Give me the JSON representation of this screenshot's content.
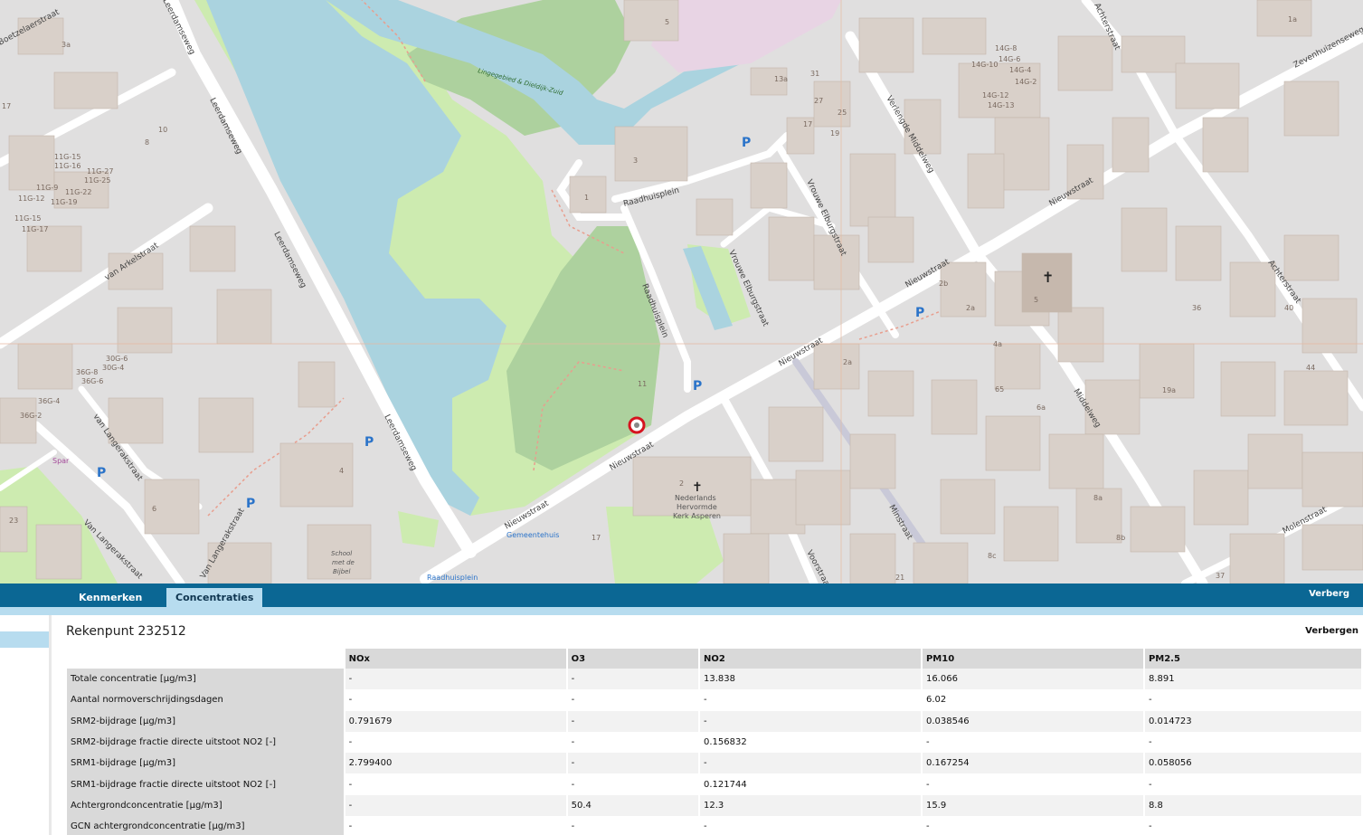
{
  "map": {
    "streets": {
      "leerdamseweg": "Leerdamseweg",
      "leerdamseweg_2": "Leerdamseweg",
      "leerdamseweg_3": "Leerdamseweg",
      "van_arkelstraat": "van Arkelstraat",
      "van_langerakstraat": "van Langerakstraat",
      "van_langerakstraat_2": "Van Langerakstraat",
      "van_langerakstraat_3": "Van Langerakstraat",
      "raadhuisplein": "Raadhuisplein",
      "raadhuisplein_2": "Raadhuisplein",
      "nieuwstraat": "Nieuwstraat",
      "nieuwstraat_2": "Nieuwstraat",
      "nieuwstraat_3": "Nieuwstraat",
      "nieuwstraat_4": "Nieuwstraat",
      "nieuwstraat_5": "Nieuwstraat",
      "vrouwe_elburgstraat": "Vrouwe Elburgstraat",
      "vrouwe_elburgstraat_2": "Vrouwe Elburgstraat",
      "verlengde_middelweg": "Verlengde Middelweg",
      "middelweg": "Middelweg",
      "achterstraat": "Achterstraat",
      "achterstraat_2": "Achterstraat",
      "zevenhuizenseweg": "Zevenhuizenseweg",
      "molenstraat": "Molenstraat",
      "minstraat": "Minstraat",
      "voorstraat": "Voorstraat",
      "leerdamseweg_top": "Leerdamseweg",
      "boetzelaerstraat": "Boetzelaerstraat"
    },
    "pois": {
      "gemeentehuis": "Gemeentehuis",
      "raadhuisplein_stop": "Raadhuisplein",
      "spar": "Spar",
      "church": "Nederlands Hervormde Kerk Asperen",
      "church_l1": "Nederlands",
      "church_l2": "Hervormde",
      "church_l3": "Kerk Asperen",
      "school_l1": "School",
      "school_l2": "met de",
      "school_l3": "Bijbel",
      "lingegebied": "Lingegebied & Dieldijk-Zuid"
    },
    "house_numbers": {
      "h1": "5",
      "h2": "1a",
      "h3": "3a",
      "h4": "17",
      "h5": "10",
      "h6": "8",
      "h7": "11G-16",
      "h8": "11G-15",
      "h9": "11G-27",
      "h10": "11G-25",
      "h11": "11G-22",
      "h12": "11G-19",
      "h13": "11G-12",
      "h14": "11G-9",
      "h15": "11G-15",
      "h16": "11G-17",
      "h17": "30G-6",
      "h18": "30G-4",
      "h19": "36G-8",
      "h20": "36G-4",
      "h21": "36G-2",
      "h22": "36G-6",
      "h23": "14G-8",
      "h24": "14G-6",
      "h25": "14G-4",
      "h26": "14G-10",
      "h27": "14G-2",
      "h28": "14G-12",
      "h29": "14G-13",
      "h30": "13a",
      "h31": "31",
      "h32": "25",
      "h33": "27",
      "h34": "19",
      "h35": "17",
      "h36": "2a",
      "h37": "4a",
      "h38": "6a",
      "h39": "8a",
      "h40": "8b",
      "h41": "8c",
      "h42": "65",
      "h43": "19a",
      "h44": "2b",
      "h45": "36",
      "h46": "44",
      "h47": "40",
      "h48": "37",
      "h49": "21",
      "h50": "23",
      "h51": "6",
      "h52": "5",
      "h53": "4",
      "h54": "2",
      "h55": "3",
      "h56": "1",
      "h57": "11",
      "h58": "17",
      "h59": "2a"
    },
    "parking": "P"
  },
  "tabs": {
    "kenmerken": "Kenmerken",
    "concentraties": "Concentraties",
    "verberg": "Verberg"
  },
  "panel": {
    "title": "Rekenpunt 232512",
    "verbergen": "Verbergen",
    "columns": [
      "",
      "NOx",
      "O3",
      "NO2",
      "PM10",
      "PM2.5"
    ],
    "rows": [
      [
        "Totale concentratie [µg/m3]",
        "-",
        "-",
        "13.838",
        "16.066",
        "8.891"
      ],
      [
        "Aantal normoverschrijdingsdagen",
        "-",
        "-",
        "-",
        "6.02",
        "-"
      ],
      [
        "SRM2-bijdrage [µg/m3]",
        "0.791679",
        "-",
        "-",
        "0.038546",
        "0.014723"
      ],
      [
        "SRM2-bijdrage fractie directe uitstoot NO2 [-]",
        "-",
        "-",
        "0.156832",
        "-",
        "-"
      ],
      [
        "SRM1-bijdrage [µg/m3]",
        "2.799400",
        "-",
        "-",
        "0.167254",
        "0.058056"
      ],
      [
        "SRM1-bijdrage fractie directe uitstoot NO2 [-]",
        "-",
        "-",
        "0.121744",
        "-",
        "-"
      ],
      [
        "Achtergrondconcentratie [µg/m3]",
        "-",
        "50.4",
        "12.3",
        "15.9",
        "8.8"
      ],
      [
        "GCN achtergrondconcentratie [µg/m3]",
        "-",
        "-",
        "-",
        "-",
        "-"
      ]
    ]
  },
  "colors": {
    "tabbar": "#0b6794",
    "tab_active": "#b7dcef",
    "water": "#aad3df",
    "park": "#cdebb0",
    "wood": "#add19e",
    "building": "#d9d0c9",
    "marker": "#d6141f"
  }
}
